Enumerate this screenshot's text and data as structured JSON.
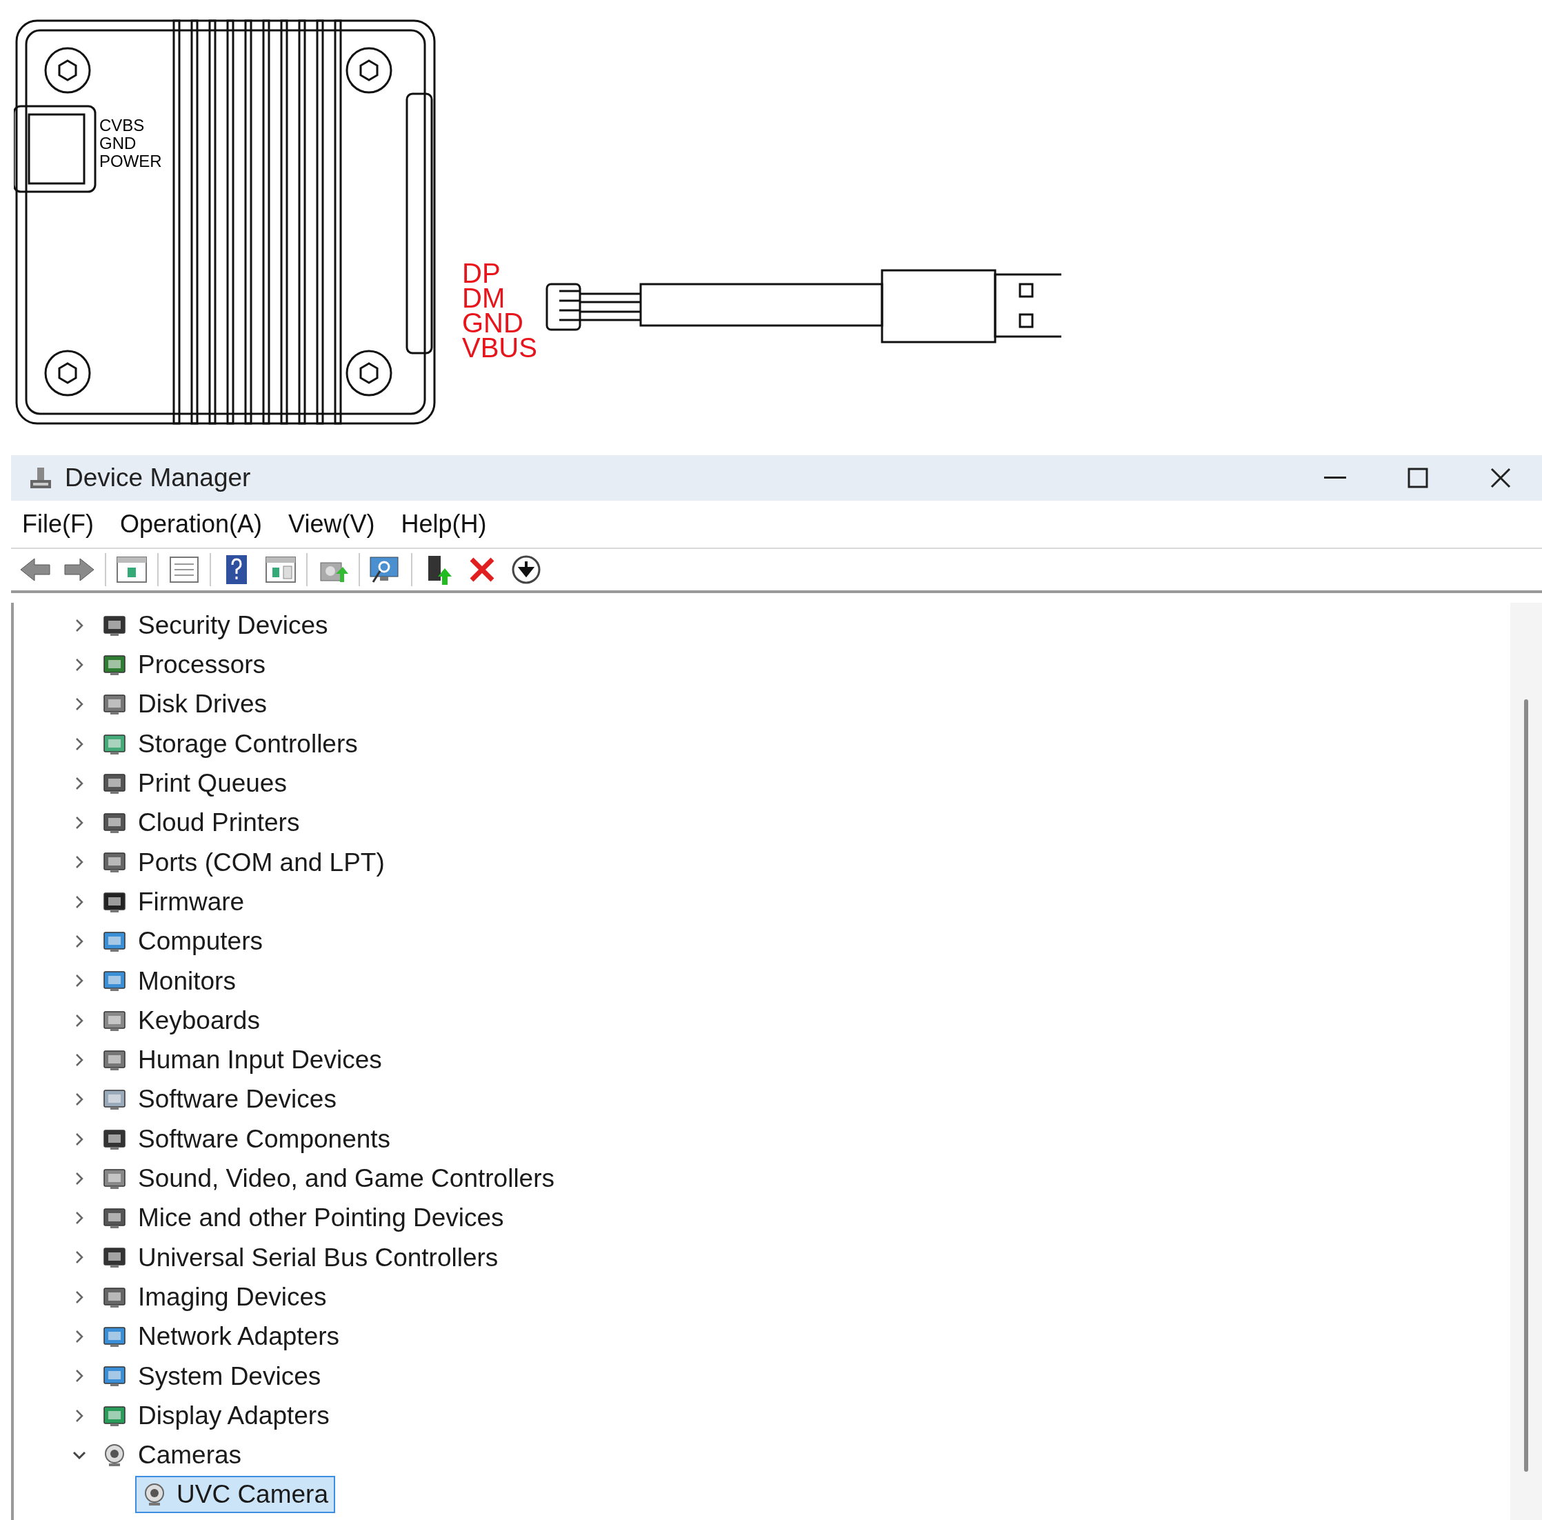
{
  "diagram": {
    "connector_labels": [
      "CVBS",
      "GND",
      "POWER"
    ],
    "pin_labels": [
      "DP",
      "DM",
      "GND",
      "VBUS"
    ]
  },
  "window": {
    "title": "Device Manager"
  },
  "menu": [
    "File(F)",
    "Operation(A)",
    "View(V)",
    "Help(H)"
  ],
  "tree": [
    {
      "label": "Security Devices",
      "expanded": false,
      "selected": false
    },
    {
      "label": "Processors",
      "expanded": false,
      "selected": false
    },
    {
      "label": "Disk Drives",
      "expanded": false,
      "selected": false
    },
    {
      "label": "Storage Controllers",
      "expanded": false,
      "selected": false
    },
    {
      "label": "Print Queues",
      "expanded": false,
      "selected": false
    },
    {
      "label": "Cloud Printers",
      "expanded": false,
      "selected": false
    },
    {
      "label": "Ports (COM and LPT)",
      "expanded": false,
      "selected": false
    },
    {
      "label": "Firmware",
      "expanded": false,
      "selected": false
    },
    {
      "label": "Computers",
      "expanded": false,
      "selected": false
    },
    {
      "label": "Monitors",
      "expanded": false,
      "selected": false
    },
    {
      "label": "Keyboards",
      "expanded": false,
      "selected": false
    },
    {
      "label": "Human Input Devices",
      "expanded": false,
      "selected": false
    },
    {
      "label": "Software Devices",
      "expanded": false,
      "selected": false
    },
    {
      "label": "Software Components",
      "expanded": false,
      "selected": false
    },
    {
      "label": "Sound, Video, and Game Controllers",
      "expanded": false,
      "selected": false
    },
    {
      "label": "Mice and other Pointing Devices",
      "expanded": false,
      "selected": false
    },
    {
      "label": "Universal Serial Bus Controllers",
      "expanded": false,
      "selected": false
    },
    {
      "label": "Imaging Devices",
      "expanded": false,
      "selected": false
    },
    {
      "label": "Network Adapters",
      "expanded": false,
      "selected": false
    },
    {
      "label": "System Devices",
      "expanded": false,
      "selected": false
    },
    {
      "label": "Display Adapters",
      "expanded": false,
      "selected": false
    },
    {
      "label": "Cameras",
      "expanded": true,
      "selected": false,
      "children": [
        {
          "label": "UVC Camera",
          "selected": true
        }
      ]
    }
  ]
}
